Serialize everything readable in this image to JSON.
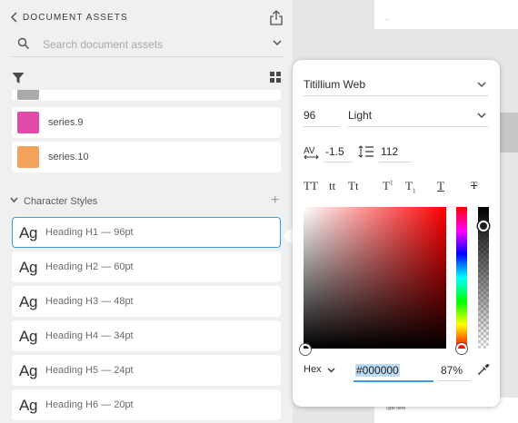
{
  "panel": {
    "title": "DOCUMENT ASSETS",
    "search_placeholder": "Search document assets",
    "colors": [
      {
        "label": "",
        "hex": "#a9a9a9"
      },
      {
        "label": "series.9",
        "hex": "#e14ba9"
      },
      {
        "label": "series.10",
        "hex": "#f5a25d"
      }
    ],
    "section_title": "Character Styles",
    "styles": [
      {
        "glyph": "Ag",
        "label": "Heading H1 — 96pt",
        "selected": true
      },
      {
        "glyph": "Ag",
        "label": "Heading H2 — 60pt"
      },
      {
        "glyph": "Ag",
        "label": "Heading H3 — 48pt"
      },
      {
        "glyph": "Ag",
        "label": "Heading H4 — 34pt"
      },
      {
        "glyph": "Ag",
        "label": "Heading H5 — 24pt"
      },
      {
        "glyph": "Ag",
        "label": "Heading H6 — 20pt"
      }
    ]
  },
  "canvas": {
    "type_here": "Type here"
  },
  "popover": {
    "font_family": "Titillium Web",
    "font_size": "96",
    "font_weight": "Light",
    "character_spacing": "-1.5",
    "line_spacing": "112",
    "text_styles": [
      "TT",
      "tt",
      "Tt",
      "T",
      "T",
      "T",
      "T"
    ],
    "superscript": "1",
    "subscript": "1",
    "color_mode": "Hex",
    "hex": "#000000",
    "opacity": "87%"
  },
  "icons": [
    "chevron-left-icon",
    "share-icon",
    "search-icon",
    "chevron-down-icon",
    "filter-icon",
    "grid-view-icon",
    "plus-icon",
    "character-spacing-icon",
    "line-spacing-icon",
    "eyedropper-icon"
  ]
}
